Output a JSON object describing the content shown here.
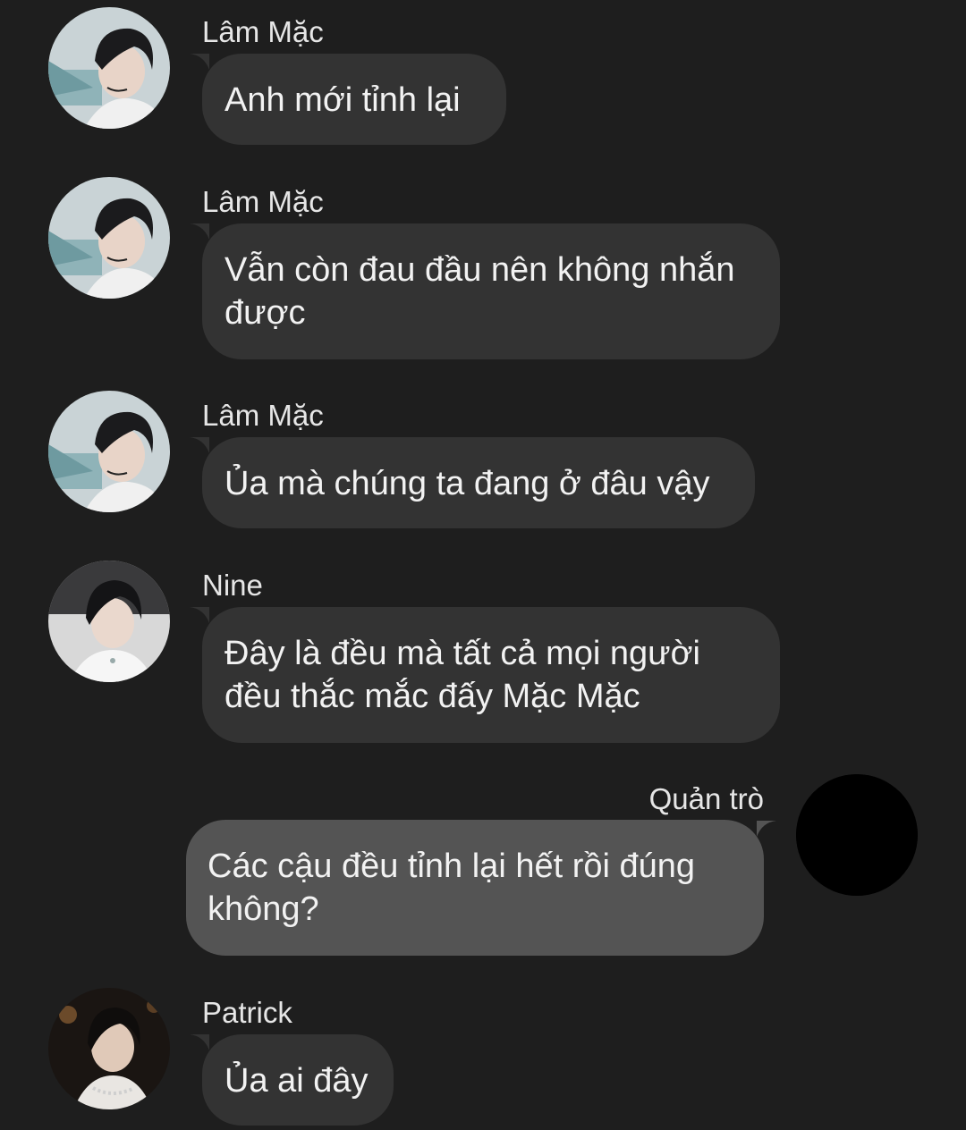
{
  "messages": [
    {
      "sender": "Lâm Mặc",
      "text": "Anh mới tỉnh lại",
      "avatar_icon": "profile-photo-lam-mac",
      "side": "left"
    },
    {
      "sender": "Lâm Mặc",
      "text": "Vẫn còn đau đầu nên không nhắn được",
      "avatar_icon": "profile-photo-lam-mac",
      "side": "left"
    },
    {
      "sender": "Lâm Mặc",
      "text": "Ủa mà chúng ta đang ở đâu vậy",
      "avatar_icon": "profile-photo-lam-mac",
      "side": "left"
    },
    {
      "sender": "Nine",
      "text": "Đây là đều mà tất cả mọi người đều thắc mắc đấy Mặc Mặc",
      "avatar_icon": "profile-photo-nine",
      "side": "left"
    },
    {
      "sender": "Quản trò",
      "text": "Các cậu đều tỉnh lại hết rồi đúng không?",
      "avatar_icon": "black-avatar",
      "side": "right"
    },
    {
      "sender": "Patrick",
      "text": "Ủa ai đây",
      "avatar_icon": "profile-photo-patrick",
      "side": "left"
    }
  ],
  "colors": {
    "background": "#1e1e1e",
    "bubble_incoming": "#333333",
    "bubble_outgoing": "#545454",
    "text": "#f2f2f2",
    "sender_text": "#e6e6e6"
  }
}
